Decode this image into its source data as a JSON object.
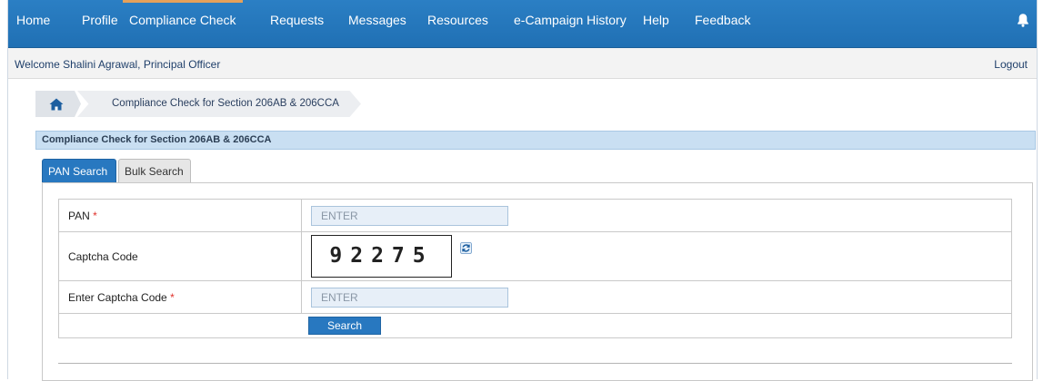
{
  "nav": {
    "items": [
      {
        "label": "Home"
      },
      {
        "label": "Profile"
      },
      {
        "label": "Compliance Check"
      },
      {
        "label": "Requests"
      },
      {
        "label": "Messages"
      },
      {
        "label": "Resources"
      },
      {
        "label": "e-Campaign History"
      },
      {
        "label": "Help"
      },
      {
        "label": "Feedback"
      }
    ],
    "active": "Compliance Check",
    "bell_icon": "bell-icon"
  },
  "welcome": {
    "text": "Welcome Shalini Agrawal, Principal Officer",
    "logout": "Logout"
  },
  "breadcrumb": {
    "home_icon": "home-icon",
    "current": "Compliance Check for Section 206AB & 206CCA"
  },
  "section": {
    "title": "Compliance Check for Section 206AB & 206CCA"
  },
  "tabs": [
    {
      "label": "PAN Search",
      "active": true
    },
    {
      "label": "Bulk Search",
      "active": false
    }
  ],
  "form": {
    "pan_label": "PAN",
    "pan_placeholder": "ENTER",
    "captcha_label": "Captcha Code",
    "captcha_value": "92275",
    "refresh_icon": "refresh-icon",
    "enter_captcha_label": "Enter Captcha Code",
    "enter_captcha_placeholder": "ENTER",
    "required_mark": "*",
    "search_label": "Search"
  },
  "colors": {
    "nav_bg": "#2474b8",
    "accent": "#2878c0",
    "active_tab_underline": "#e5a15a",
    "required": "#e0312b",
    "section_bar": "#c9dff2"
  }
}
